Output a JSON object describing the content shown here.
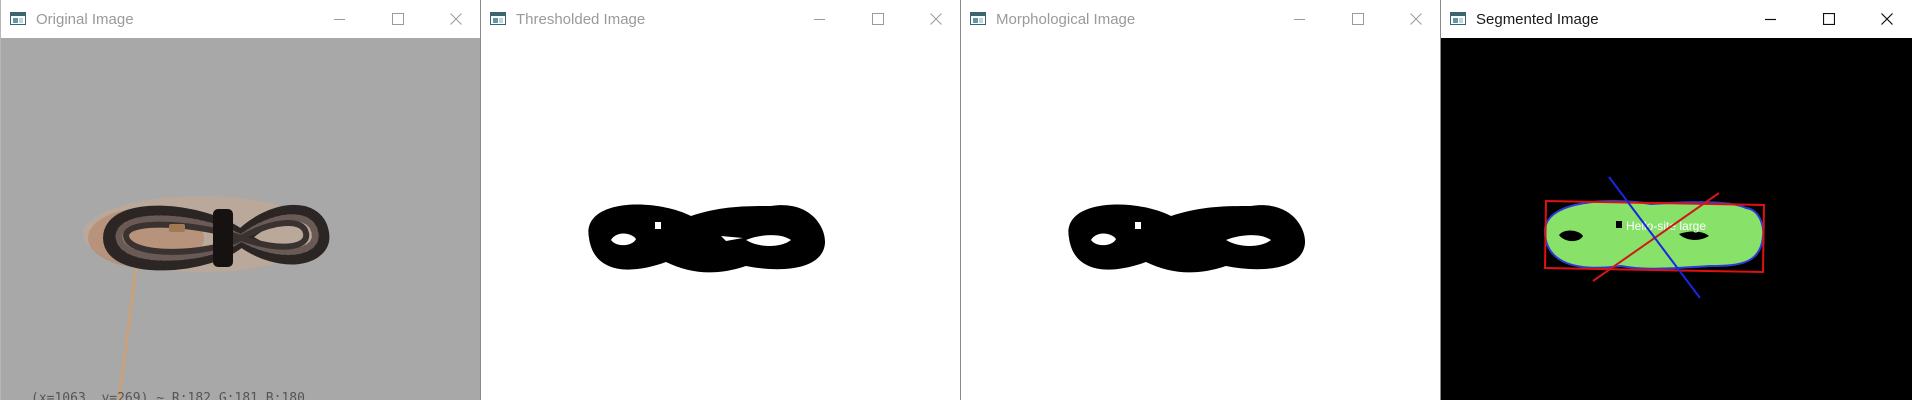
{
  "windows": [
    {
      "title": "Original Image",
      "active": false
    },
    {
      "title": "Thresholded Image",
      "active": false
    },
    {
      "title": "Morphological Image",
      "active": false
    },
    {
      "title": "Segmented Image",
      "active": true
    }
  ],
  "window_controls": {
    "minimize_icon": "minimize-icon",
    "maximize_icon": "maximize-icon",
    "close_icon": "close-icon"
  },
  "original": {
    "status_text": "(x=1063, y=269) ~ R:182 G:181 B:180"
  },
  "segmented": {
    "object_label": "Hello-site large",
    "colors": {
      "blob": "#88e26a",
      "contour": "#2a3bd8",
      "box": "#e01010",
      "axis_major": "#d01818",
      "axis_minor": "#1828e0"
    }
  }
}
